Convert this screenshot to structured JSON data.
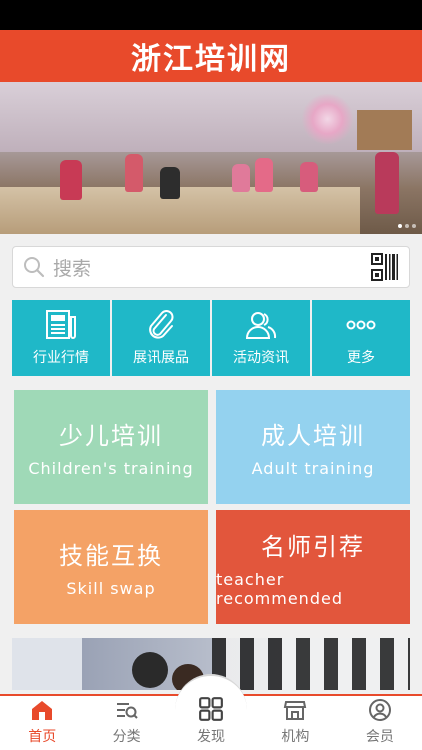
{
  "header": {
    "title": "浙江培训网"
  },
  "banner": {
    "slide_count": 3,
    "active_slide": 1
  },
  "search": {
    "placeholder": "搜索"
  },
  "quick_nav": [
    {
      "label": "行业行情",
      "icon": "newspaper-icon"
    },
    {
      "label": "展讯展品",
      "icon": "paperclip-icon"
    },
    {
      "label": "活动资讯",
      "icon": "people-icon"
    },
    {
      "label": "更多",
      "icon": "more-dots-icon"
    }
  ],
  "tiles": {
    "children": {
      "cn": "少儿培训",
      "en": "Children's training",
      "color": "#9fd9b7"
    },
    "adult": {
      "cn": "成人培训",
      "en": "Adult training",
      "color": "#94d2ef"
    },
    "skill": {
      "cn": "技能互换",
      "en": "Skill swap",
      "color": "#f4a266"
    },
    "teacher": {
      "cn": "名师引荐",
      "en": "teacher recommended",
      "color": "#e2563c"
    }
  },
  "tabbar": [
    {
      "label": "首页",
      "icon": "home-icon",
      "active": true
    },
    {
      "label": "分类",
      "icon": "category-search-icon",
      "active": false
    },
    {
      "label": "发现",
      "icon": "grid-icon",
      "active": false
    },
    {
      "label": "机构",
      "icon": "store-icon",
      "active": false
    },
    {
      "label": "会员",
      "icon": "user-icon",
      "active": false
    }
  ],
  "colors": {
    "brand": "#e84a2b",
    "quick_nav": "#1fb8c8"
  }
}
